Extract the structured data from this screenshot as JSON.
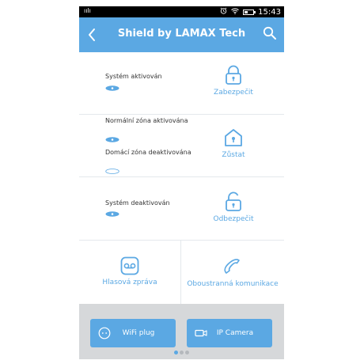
{
  "statusbar": {
    "signal_text": "ıılı",
    "time": "15:43",
    "battery_level": 0.4,
    "icons": [
      "alarm-clock-icon",
      "wifi-icon",
      "battery-icon"
    ]
  },
  "appbar": {
    "title": "Shield by LAMAX Tech",
    "back_icon": "chevron-left-icon",
    "search_icon": "search-icon"
  },
  "modes": [
    {
      "statuses": [
        {
          "text": "Systém aktivován",
          "eye": "filled"
        }
      ],
      "action_label": "Zabezpečit",
      "icon": "lock-closed-icon"
    },
    {
      "statuses": [
        {
          "text": "Normální zóna aktivována",
          "eye": "filled"
        },
        {
          "text": "Domácí zóna deaktivována",
          "eye": "outline"
        }
      ],
      "action_label": "Zůstat",
      "icon": "home-lock-icon"
    },
    {
      "statuses": [
        {
          "text": "Systém deaktivován",
          "eye": "filled"
        }
      ],
      "action_label": "Odbezpečit",
      "icon": "lock-open-icon"
    }
  ],
  "features": {
    "voice_message": "Hlasová zpráva",
    "two_way": "Oboustranná komunikace"
  },
  "bottom_buttons": {
    "wifi_plug": "WiFi plug",
    "ip_camera": "IP Camera"
  },
  "pager": {
    "count": 3,
    "active": 0
  },
  "colors": {
    "accent": "#5ba8e3",
    "bottom_bg": "#d6d8da",
    "divider": "#e4e8ec"
  }
}
